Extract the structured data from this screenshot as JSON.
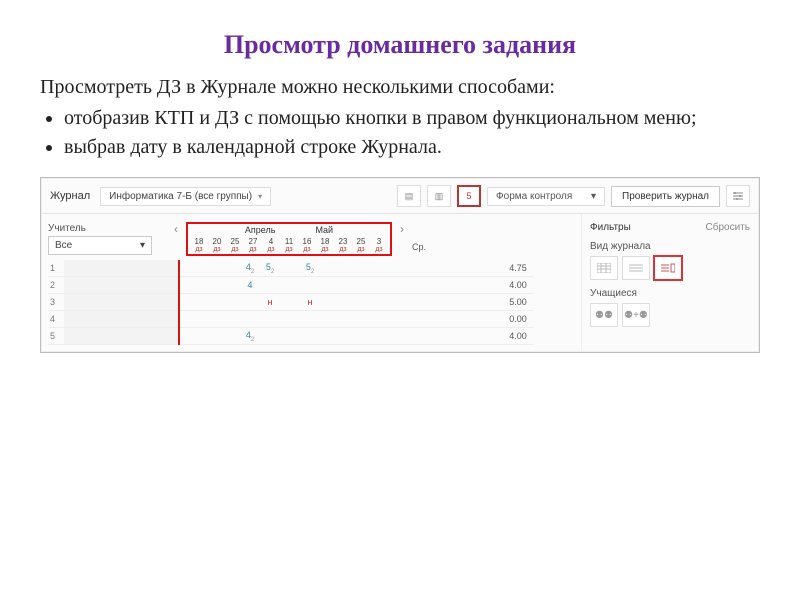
{
  "title": "Просмотр домашнего задания",
  "intro": "Просмотреть ДЗ в Журнале можно несколькими способами:",
  "bullets": [
    "отобразив КТП и ДЗ с помощью кнопки  в правом функциональном меню;",
    "выбрав дату в календарной строке Журнала."
  ],
  "journal": {
    "label": "Журнал",
    "subject": "Информатика 7-Б (все группы)",
    "form_control": "Форма контроля",
    "check_button": "Проверить журнал",
    "filters": {
      "title": "Фильтры",
      "reset": "Сбросить",
      "view_label": "Вид журнала",
      "students_label": "Учащиеся"
    },
    "teacher": {
      "label": "Учитель",
      "value": "Все"
    },
    "calendar": {
      "month1": "Апрель",
      "month2": "Май",
      "dates": [
        "18",
        "20",
        "25",
        "27",
        "4",
        "11",
        "16",
        "18",
        "23",
        "25",
        "3"
      ],
      "dz": [
        "дз",
        "дз",
        "дз",
        "дз",
        "дз",
        "дз",
        "дз",
        "дз",
        "дз",
        "дз",
        "дз"
      ],
      "avg_header": "Ср."
    },
    "rows": [
      {
        "idx": "1",
        "cells": [
          "",
          "",
          "",
          "4",
          "5",
          "",
          "5",
          "",
          "",
          "",
          ""
        ],
        "sub": [
          "",
          "",
          "",
          "2",
          "2",
          "",
          "2",
          "",
          "",
          "",
          ""
        ],
        "avg": "4.75"
      },
      {
        "idx": "2",
        "cells": [
          "",
          "",
          "",
          "4",
          "",
          "",
          "",
          "",
          "",
          "",
          ""
        ],
        "sub": [
          "",
          "",
          "",
          "",
          "",
          "",
          "",
          "",
          "",
          "",
          ""
        ],
        "avg": "4.00"
      },
      {
        "idx": "3",
        "cells": [
          "",
          "",
          "",
          "",
          "н",
          "",
          "н",
          "",
          "",
          "",
          ""
        ],
        "sub": [
          "",
          "",
          "",
          "",
          "",
          "",
          "",
          "",
          "",
          "",
          ""
        ],
        "avg": "5.00"
      },
      {
        "idx": "4",
        "cells": [
          "",
          "",
          "",
          "",
          "",
          "",
          "",
          "",
          "",
          "",
          ""
        ],
        "sub": [
          "",
          "",
          "",
          "",
          "",
          "",
          "",
          "",
          "",
          "",
          ""
        ],
        "avg": "0.00"
      },
      {
        "idx": "5",
        "cells": [
          "",
          "",
          "",
          "4",
          "",
          "",
          "",
          "",
          "",
          "",
          ""
        ],
        "sub": [
          "",
          "",
          "",
          "2",
          "",
          "",
          "",
          "",
          "",
          "",
          ""
        ],
        "avg": "4.00"
      }
    ]
  }
}
